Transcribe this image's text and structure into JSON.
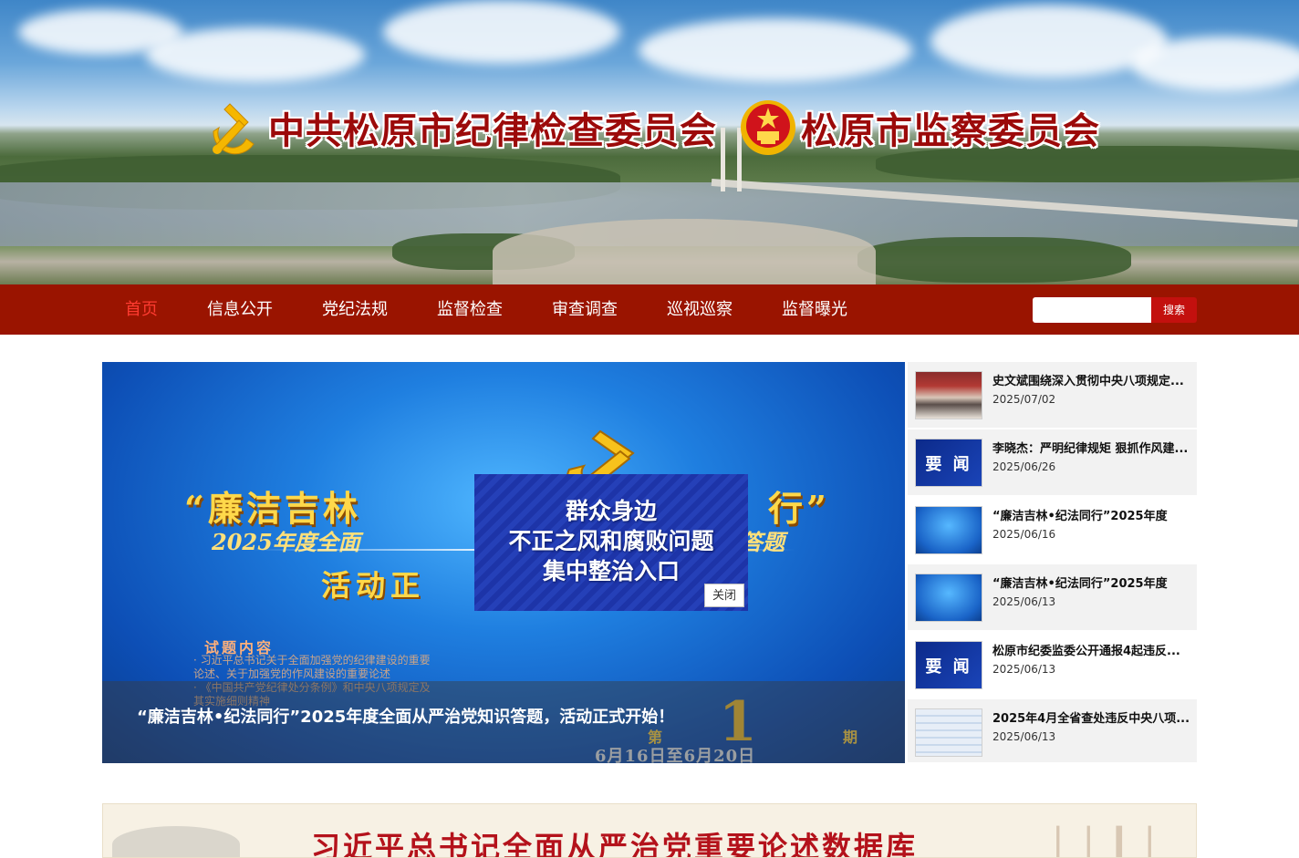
{
  "header": {
    "title_left": "中共松原市纪律检查委员会",
    "title_right": "松原市监察委员会"
  },
  "nav": {
    "items": [
      {
        "label": "首页",
        "active": true
      },
      {
        "label": "信息公开",
        "active": false
      },
      {
        "label": "党纪法规",
        "active": false
      },
      {
        "label": "监督检查",
        "active": false
      },
      {
        "label": "审查调查",
        "active": false
      },
      {
        "label": "巡视巡察",
        "active": false
      },
      {
        "label": "监督曝光",
        "active": false
      }
    ],
    "search_placeholder": "",
    "search_button": "搜索"
  },
  "slider": {
    "headline_left": "“廉洁吉林",
    "headline_right": "行”",
    "subline_left": "2025年度全面",
    "subline_right": "答题",
    "activity_left": "活动正",
    "topic_title": "试题内容",
    "topic_lines": [
      "· 习近平总书记关于全面加强党的纪律建设的重要",
      "  论述、关于加强党的作风建设的重要论述",
      "· 《中国共产党纪律处分条例》和中央八项规定及",
      "  其实施细则精神"
    ],
    "period_number": "1",
    "period_prefix": "第",
    "period_suffix": "期",
    "period_dates": "6月16日至6月20日",
    "caption": "“廉洁吉林•纪法同行”2025年度全面从严治党知识答题，活动正式开始！"
  },
  "popup": {
    "lines": [
      "群众身边",
      "不正之风和腐败问题",
      "集中整治入口"
    ],
    "close_label": "关闭"
  },
  "news": [
    {
      "title": "史文斌围绕深入贯彻中央八项规定...",
      "date": "2025/07/02",
      "thumb": "meeting"
    },
    {
      "title": "李晓杰：严明纪律规矩 狠抓作风建...",
      "date": "2025/06/26",
      "thumb": "yaowen"
    },
    {
      "title": "“廉洁吉林•纪法同行”2025年度",
      "date": "2025/06/16",
      "thumb": "blue"
    },
    {
      "title": "“廉洁吉林•纪法同行”2025年度",
      "date": "2025/06/13",
      "thumb": "blue"
    },
    {
      "title": "松原市纪委监委公开通报4起违反...",
      "date": "2025/06/13",
      "thumb": "yaowen"
    },
    {
      "title": "2025年4月全省查处违反中央八项...",
      "date": "2025/06/13",
      "thumb": "doc"
    }
  ],
  "thumb_text": "要 闻",
  "bottom_banner": {
    "text": "习近平总书记全面从严治党重要论述数据库"
  },
  "colors": {
    "nav_bg": "#9a1400",
    "nav_active": "#ff3b30",
    "search_button_bg": "#c3100e",
    "title_red": "#9c0a0a"
  }
}
